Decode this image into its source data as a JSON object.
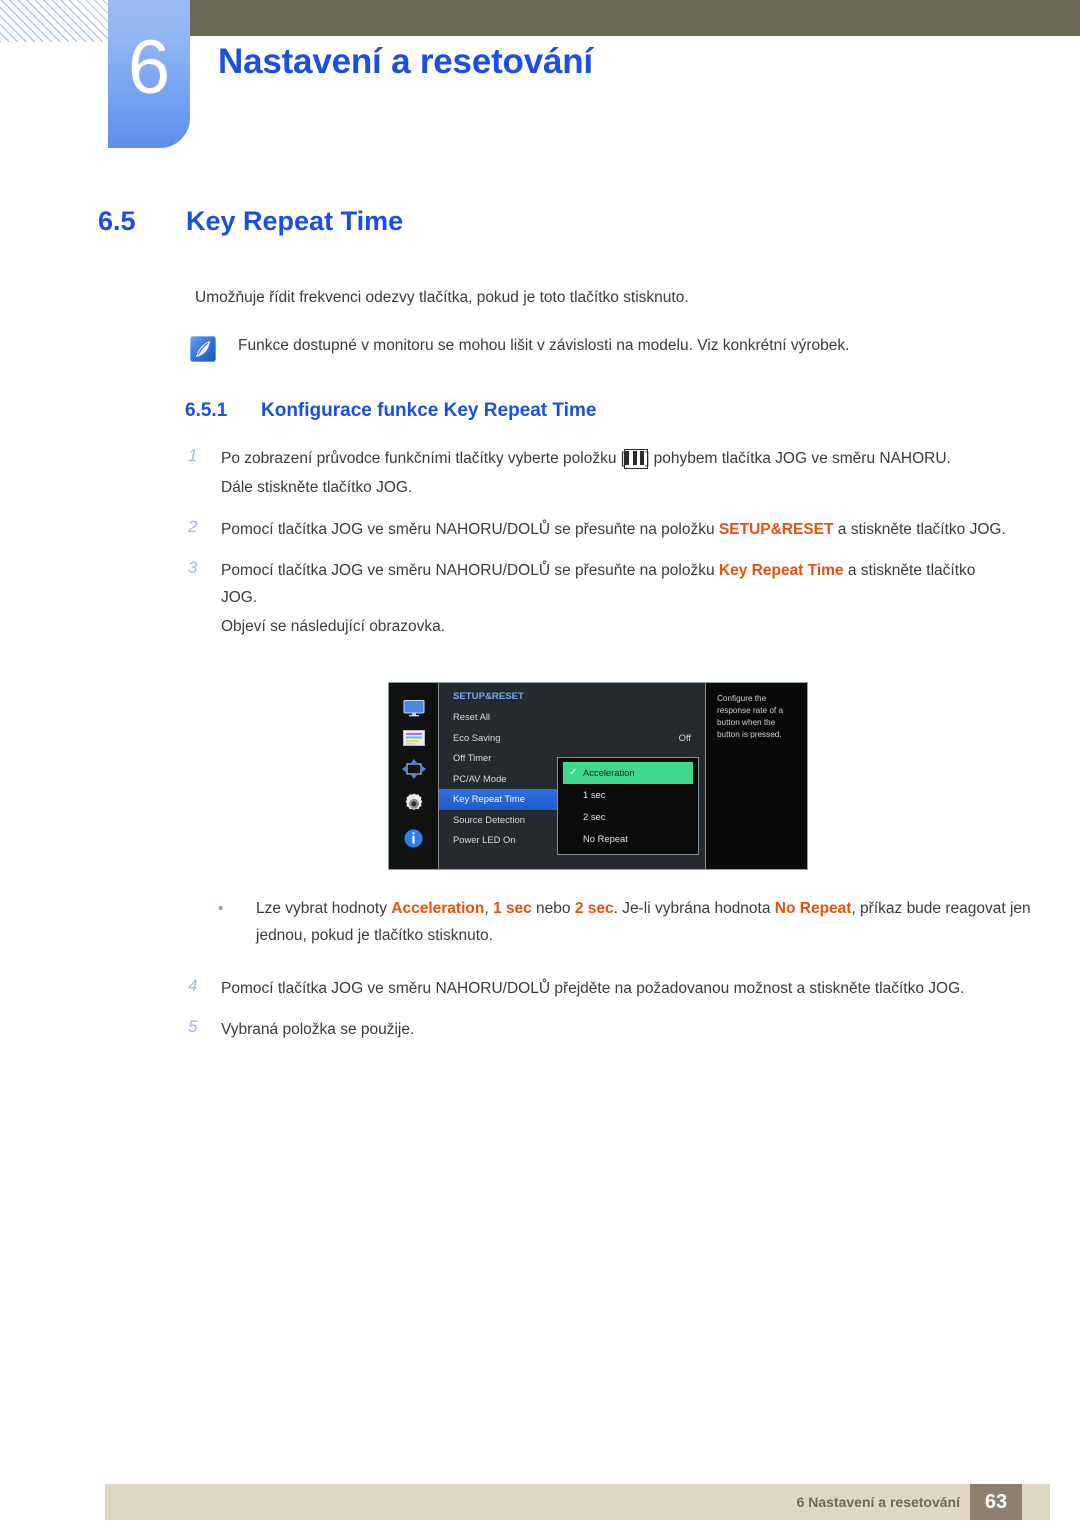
{
  "header": {
    "chapter_number": "6",
    "chapter_title": "Nastavení a resetování"
  },
  "section": {
    "number": "6.5",
    "title": "Key Repeat Time",
    "intro": "Umožňuje řídit frekvenci odezvy tlačítka, pokud je toto tlačítko stisknuto.",
    "note": "Funkce dostupné v monitoru se mohou lišit v závislosti na modelu. Viz konkrétní výrobek."
  },
  "subsection": {
    "number": "6.5.1",
    "title": "Konfigurace funkce Key Repeat Time"
  },
  "steps": [
    {
      "num": "1",
      "text_before": "Po zobrazení průvodce funkčními tlačítky vyberte položku [",
      "text_after": "] pohybem tlačítka JOG ve směru NAHORU.",
      "sub": "Dále stiskněte tlačítko JOG."
    },
    {
      "num": "2",
      "text_before": "Pomocí tlačítka JOG ve směru NAHORU/DOLŮ se přesuňte na položku ",
      "highlight": "SETUP&RESET",
      "text_after": " a stiskněte tlačítko JOG."
    },
    {
      "num": "3",
      "text_before": "Pomocí tlačítka JOG ve směru NAHORU/DOLŮ se přesuňte na položku ",
      "highlight": "Key Repeat Time",
      "text_after": " a stiskněte tlačítko JOG.",
      "sub": "Objeví se následující obrazovka."
    },
    {
      "num": "4",
      "text_before": "Pomocí tlačítka JOG ve směru NAHORU/DOLŮ přejděte na požadovanou možnost a stiskněte tlačítko JOG.",
      "text_after": ""
    },
    {
      "num": "5",
      "text_before": "Vybraná položka se použije.",
      "text_after": ""
    }
  ],
  "bullet": {
    "marker": "•",
    "p1": "Lze vybrat hodnoty ",
    "h1": "Acceleration",
    "p2": ", ",
    "h2": "1 sec",
    "p3": " nebo ",
    "h3": "2 sec",
    "p4": ". Je-li vybrána hodnota ",
    "h4": "No Repeat",
    "p5": ", příkaz bude reagovat jen jednou, pokud je tlačítko stisknuto."
  },
  "osd": {
    "menu_title": "SETUP&RESET",
    "sidebar_icons": [
      "monitor-icon",
      "picture-settings-icon",
      "onscreen-display-icon",
      "gear-icon",
      "information-icon"
    ],
    "items": [
      {
        "label": "Reset All",
        "value": ""
      },
      {
        "label": "Eco Saving",
        "value": "Off"
      },
      {
        "label": "Off Timer",
        "value": ""
      },
      {
        "label": "PC/AV Mode",
        "value": ""
      },
      {
        "label": "Key Repeat Time",
        "value": "",
        "selected": true
      },
      {
        "label": "Source Detection",
        "value": ""
      },
      {
        "label": "Power LED On",
        "value": ""
      }
    ],
    "submenu": [
      {
        "label": "Acceleration",
        "checked": true
      },
      {
        "label": "1 sec",
        "checked": false
      },
      {
        "label": "2 sec",
        "checked": false
      },
      {
        "label": "No Repeat",
        "checked": false
      }
    ],
    "description": "Configure the response rate of a button when the button is pressed."
  },
  "footer": {
    "text": "6 Nastavení a resetování",
    "page": "63"
  },
  "colors": {
    "accent_blue": "#1a4fe0",
    "highlight_orange": "#e8500f",
    "olive": "#6d6a55",
    "footer_beige": "#ded7c5",
    "osd_select_blue": "#2f6fe0",
    "osd_check_green": "#3fd88c"
  }
}
